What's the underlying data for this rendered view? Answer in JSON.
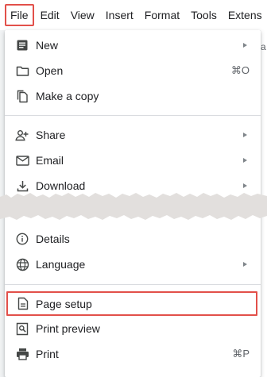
{
  "menubar": {
    "items": [
      "File",
      "Edit",
      "View",
      "Insert",
      "Format",
      "Tools",
      "Extens"
    ],
    "active_index": 0
  },
  "background_fragment": "a",
  "menu": {
    "items": [
      {
        "label": "New",
        "icon": "document-icon",
        "submenu": true
      },
      {
        "label": "Open",
        "icon": "folder-icon",
        "shortcut": "⌘O"
      },
      {
        "label": "Make a copy",
        "icon": "copy-icon"
      },
      {
        "label": "Share",
        "icon": "share-person-icon",
        "submenu": true
      },
      {
        "label": "Email",
        "icon": "email-icon",
        "submenu": true
      },
      {
        "label": "Download",
        "icon": "download-icon",
        "submenu": true
      },
      {
        "label": "Details",
        "icon": "info-icon"
      },
      {
        "label": "Language",
        "icon": "globe-icon",
        "submenu": true
      },
      {
        "label": "Page setup",
        "icon": "page-icon",
        "highlighted": true
      },
      {
        "label": "Print preview",
        "icon": "print-preview-icon"
      },
      {
        "label": "Print",
        "icon": "printer-icon",
        "shortcut": "⌘P"
      }
    ]
  },
  "colors": {
    "highlight_border": "#e2504a",
    "menu_bg": "#ffffff",
    "text": "#202124",
    "secondary_text": "#5f6368"
  }
}
